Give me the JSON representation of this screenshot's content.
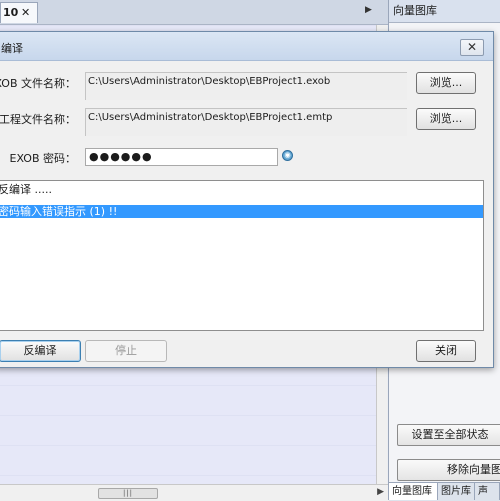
{
  "background": {
    "tab_label": "10",
    "tab_close": "✕",
    "tab_scroll_arrow": "▶",
    "hscroll_thumb": "|||",
    "hscroll_arrow": "▶"
  },
  "right_panel": {
    "title": "向量图库",
    "button_set_all": "设置至全部状态",
    "button_remove": "移除向量图",
    "tabs": [
      "向量图库",
      "图片库",
      "声"
    ]
  },
  "dialog": {
    "title": "编译",
    "close_glyph": "✕",
    "exob_label": "EXOB 文件名称：",
    "exob_path": "C:\\Users\\Administrator\\Desktop\\EBProject1.exob",
    "project_label": "工程文件名称：",
    "project_path": "C:\\Users\\Administrator\\Desktop\\EBProject1.emtp",
    "browse_label": "浏览...",
    "password_label": "EXOB 密码：",
    "password_value": "●●●●●●",
    "log": [
      "反编译 .....",
      "",
      "密码输入错误指示 (1) !!"
    ],
    "decompile_button": "反编译",
    "stop_button": "停止",
    "close_button": "关闭"
  }
}
